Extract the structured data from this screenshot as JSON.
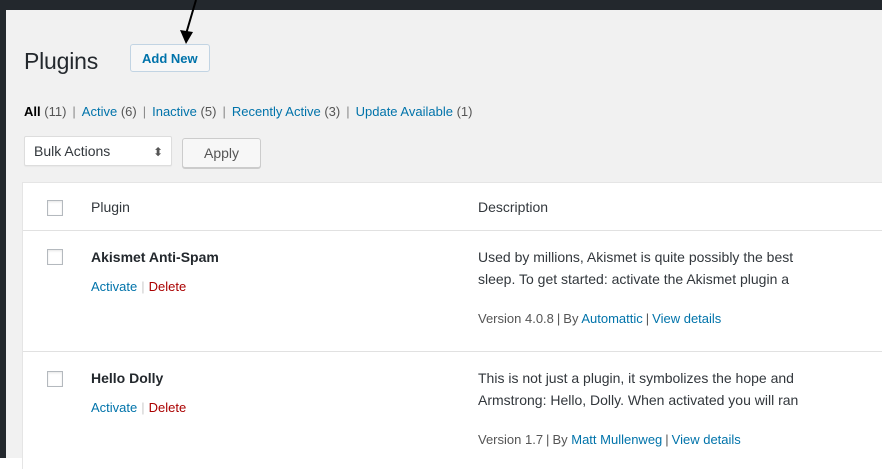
{
  "page": {
    "title": "Plugins",
    "add_new_label": "Add New"
  },
  "filters": [
    {
      "label": "All",
      "count": "(11)",
      "current": true
    },
    {
      "label": "Active",
      "count": "(6)"
    },
    {
      "label": "Inactive",
      "count": "(5)"
    },
    {
      "label": "Recently Active",
      "count": "(3)"
    },
    {
      "label": "Update Available",
      "count": "(1)"
    }
  ],
  "bulk": {
    "select_value": "Bulk Actions",
    "apply_label": "Apply"
  },
  "table": {
    "headers": {
      "plugin": "Plugin",
      "description": "Description"
    },
    "rows": [
      {
        "name": "Akismet Anti-Spam",
        "activate": "Activate",
        "delete": "Delete",
        "desc_line1": "Used by millions, Akismet is quite possibly the best",
        "desc_line2": "sleep. To get started: activate the Akismet plugin a",
        "version": "Version 4.0.8",
        "by": "By",
        "author": "Automattic",
        "view_details": "View details"
      },
      {
        "name": "Hello Dolly",
        "activate": "Activate",
        "delete": "Delete",
        "desc_line1": "This is not just a plugin, it symbolizes the hope and",
        "desc_line2": "Armstrong: Hello, Dolly. When activated you will ran",
        "version": "Version 1.7",
        "by": "By",
        "author": "Matt Mullenweg",
        "view_details": "View details"
      }
    ]
  },
  "icons": {
    "arrow": "annotation-arrow-icon",
    "select_caret": "updown-caret-icon"
  },
  "colors": {
    "link": "#0073aa",
    "delete": "#aa0000",
    "admin_bar": "#23282d",
    "background": "#f1f1f1"
  }
}
